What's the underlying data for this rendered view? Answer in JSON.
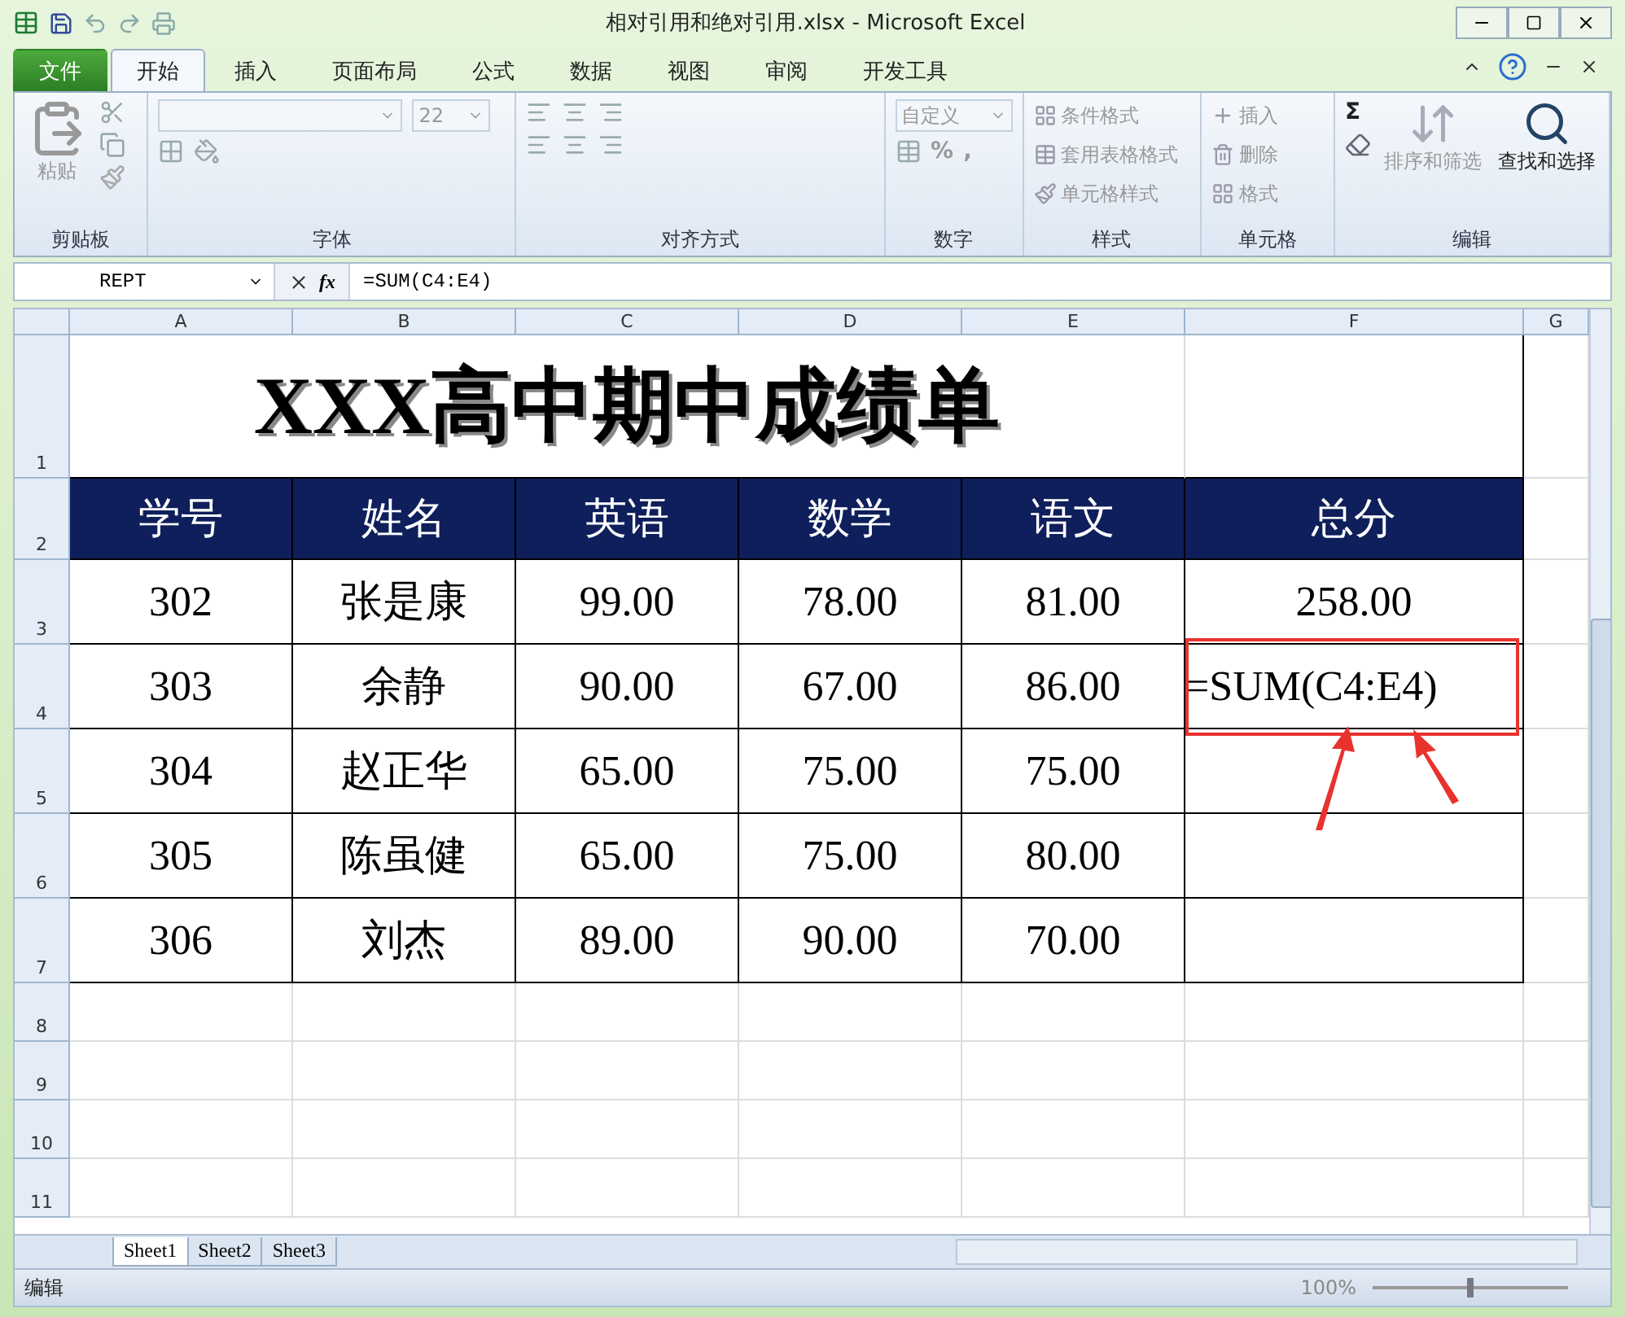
{
  "window": {
    "title": "相对引用和绝对引用.xlsx - Microsoft Excel"
  },
  "tabs": [
    {
      "label": "文件",
      "kind": "file",
      "selected": false
    },
    {
      "label": "开始",
      "kind": "tab",
      "selected": true
    },
    {
      "label": "插入",
      "kind": "tab",
      "selected": false
    },
    {
      "label": "页面布局",
      "kind": "tab",
      "selected": false
    },
    {
      "label": "公式",
      "kind": "tab",
      "selected": false
    },
    {
      "label": "数据",
      "kind": "tab",
      "selected": false
    },
    {
      "label": "视图",
      "kind": "tab",
      "selected": false
    },
    {
      "label": "审阅",
      "kind": "tab",
      "selected": false
    },
    {
      "label": "开发工具",
      "kind": "tab",
      "selected": false
    }
  ],
  "ribbon": [
    {
      "kind": "clipboard",
      "label": "剪贴板",
      "paste": "粘贴",
      "disabled": true
    },
    {
      "kind": "font",
      "label": "字体",
      "size": "22",
      "disabled": true
    },
    {
      "kind": "alignment",
      "label": "对齐方式",
      "disabled": true
    },
    {
      "kind": "number",
      "label": "数字",
      "format": "自定义",
      "percent": "%",
      "comma": ",",
      "disabled": true
    },
    {
      "kind": "styles",
      "label": "样式",
      "buttons": [
        "条件格式",
        "套用表格格式",
        "单元格样式"
      ],
      "disabled": true
    },
    {
      "kind": "cells",
      "label": "单元格",
      "buttons": [
        "插入",
        "删除",
        "格式"
      ],
      "disabled": true
    },
    {
      "kind": "editing",
      "label": "编辑",
      "sigma": "Σ",
      "sort": {
        "label": "排序和筛选",
        "disabled": true
      },
      "find": {
        "label": "查找和选择",
        "disabled": false
      }
    }
  ],
  "formula_bar": {
    "name_box": "REPT",
    "fx": "fx",
    "formula": "=SUM(C4:E4)"
  },
  "sheet": {
    "columns": [
      "A",
      "B",
      "C",
      "D",
      "E",
      "F",
      "G"
    ],
    "rows": [
      {
        "number": "1",
        "kind": "title",
        "title": "XXX高中期中成绩单"
      },
      {
        "number": "2",
        "kind": "header",
        "cells": [
          "学号",
          "姓名",
          "英语",
          "数学",
          "语文",
          "总分"
        ]
      },
      {
        "number": "3",
        "kind": "data",
        "highlighted": false,
        "cells": [
          "302",
          "张是康",
          "99.00",
          "78.00",
          "81.00",
          "258.00"
        ]
      },
      {
        "number": "4",
        "kind": "data",
        "highlighted": true,
        "cells": [
          "303",
          "余静",
          "90.00",
          "67.00",
          "86.00",
          "=SUM(C4:E4)"
        ]
      },
      {
        "number": "5",
        "kind": "data",
        "highlighted": false,
        "cells": [
          "304",
          "赵正华",
          "65.00",
          "75.00",
          "75.00"
        ]
      },
      {
        "number": "6",
        "kind": "data",
        "highlighted": false,
        "cells": [
          "305",
          "陈虽健",
          "65.00",
          "75.00",
          "80.00"
        ]
      },
      {
        "number": "7",
        "kind": "data",
        "highlighted": false,
        "cells": [
          "306",
          "刘杰",
          "89.00",
          "90.00",
          "70.00"
        ]
      },
      {
        "number": "8",
        "kind": "empty"
      },
      {
        "number": "9",
        "kind": "empty"
      },
      {
        "number": "10",
        "kind": "empty"
      },
      {
        "number": "11",
        "kind": "empty"
      }
    ]
  },
  "sheet_tabs": [
    {
      "label": "Sheet1",
      "selected": true
    },
    {
      "label": "Sheet2",
      "selected": false
    },
    {
      "label": "Sheet3",
      "selected": false
    }
  ],
  "status_bar": {
    "mode": "编辑",
    "zoom": "100%",
    "zoom_slider": {
      "level": 0.5
    }
  }
}
